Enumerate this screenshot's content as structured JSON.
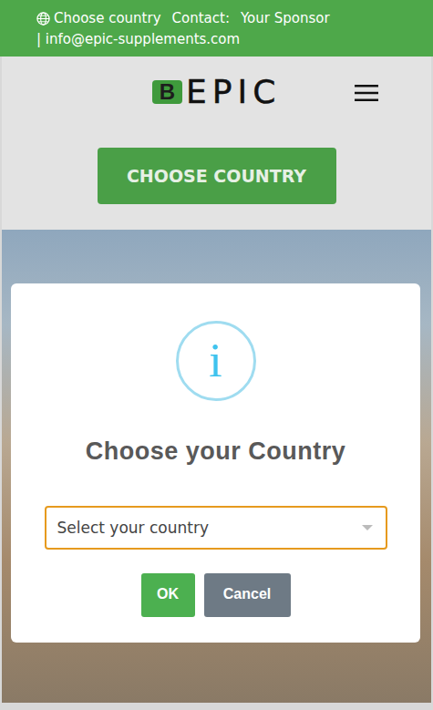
{
  "top_bar": {
    "choose_country": "Choose country",
    "contact_label": "Contact:",
    "sponsor": "Your Sponsor",
    "email": "| info@epic-supplements.com"
  },
  "logo": {
    "mark": "B",
    "text": "EPIC"
  },
  "choose_button": "CHOOSE COUNTRY",
  "dialog": {
    "icon": "i",
    "title": "Choose your Country",
    "select": {
      "placeholder": "Select your country"
    },
    "buttons": [
      "OK",
      "Cancel"
    ]
  }
}
